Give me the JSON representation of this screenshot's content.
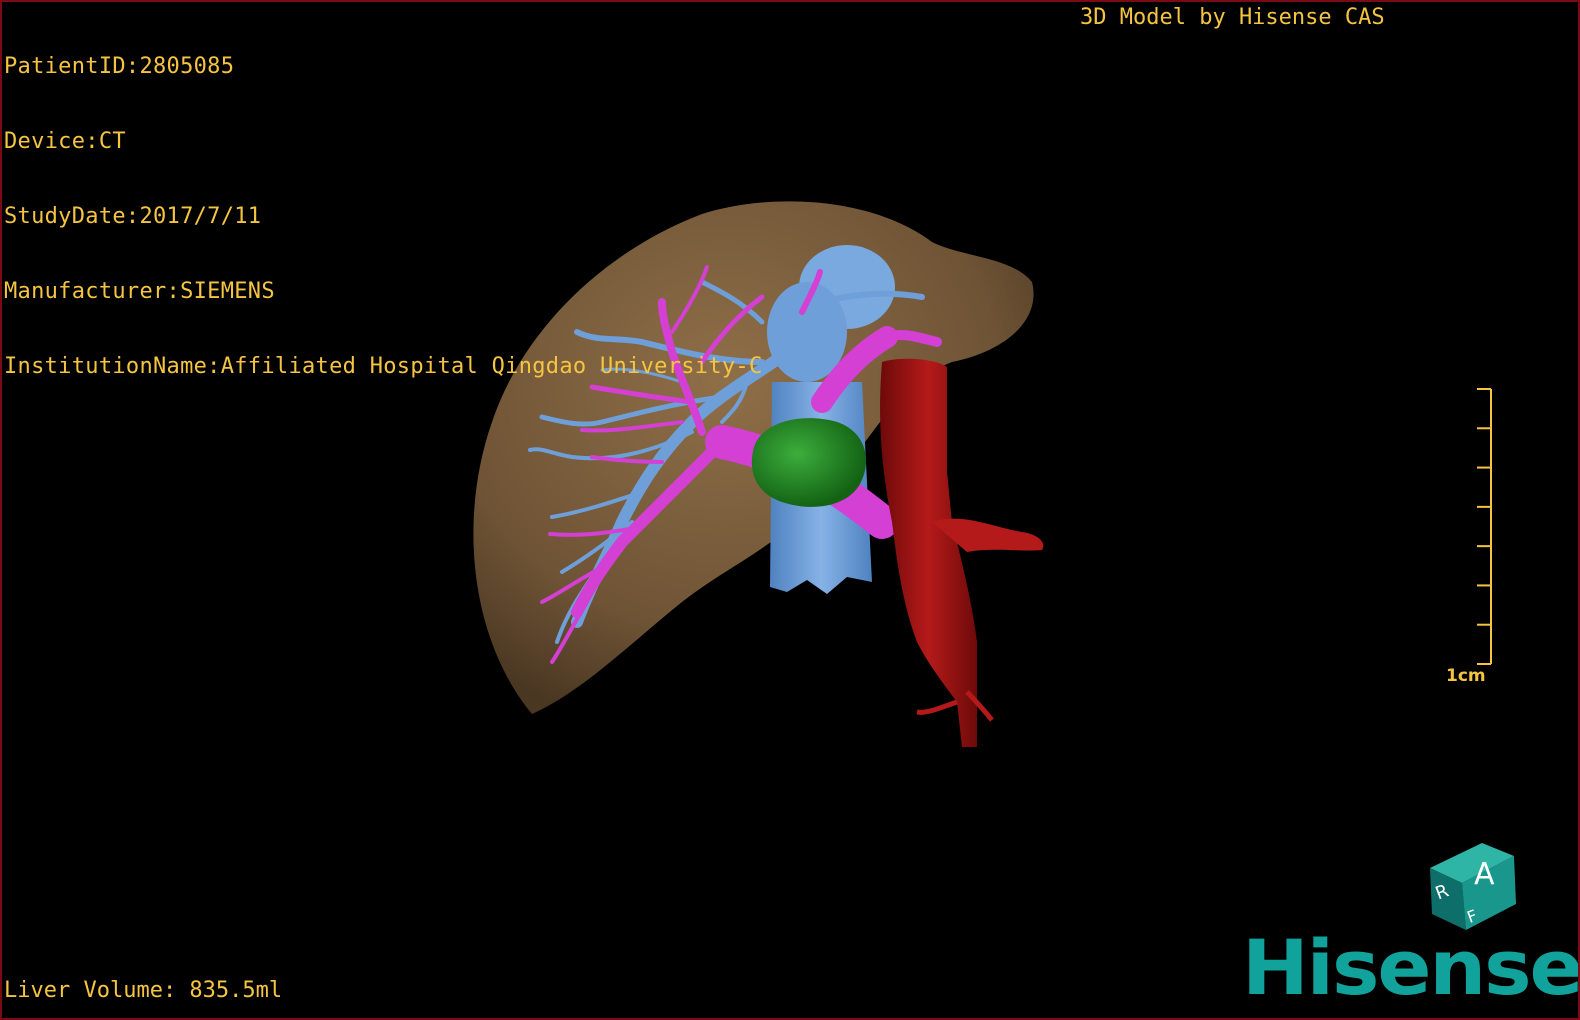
{
  "study_info": {
    "patient_id": "PatientID:2805085",
    "device": "Device:CT",
    "study_date": "StudyDate:2017/7/11",
    "manufacturer": "Manufacturer:SIEMENS",
    "institution": "InstitutionName:Affiliated Hospital Qingdao University-C"
  },
  "credit": "3D Model by Hisense CAS",
  "liver_volume": "Liver Volume: 835.5ml",
  "scale": {
    "label": "1cm",
    "ticks": 8
  },
  "orientation_cube": {
    "face_front": "A",
    "face_left": "R",
    "face_bottom": "F"
  },
  "brand": {
    "logo_text": "Hisense",
    "color": "#11a39b"
  },
  "colors": {
    "overlay_text": "#f5c542",
    "liver": "#8a6a45",
    "hepatic_vein": "#6f9fd8",
    "portal_vein": "#d43fd4",
    "tumor": "#1f8a1f",
    "aorta": "#a51414",
    "frame": "#7a0b14"
  }
}
